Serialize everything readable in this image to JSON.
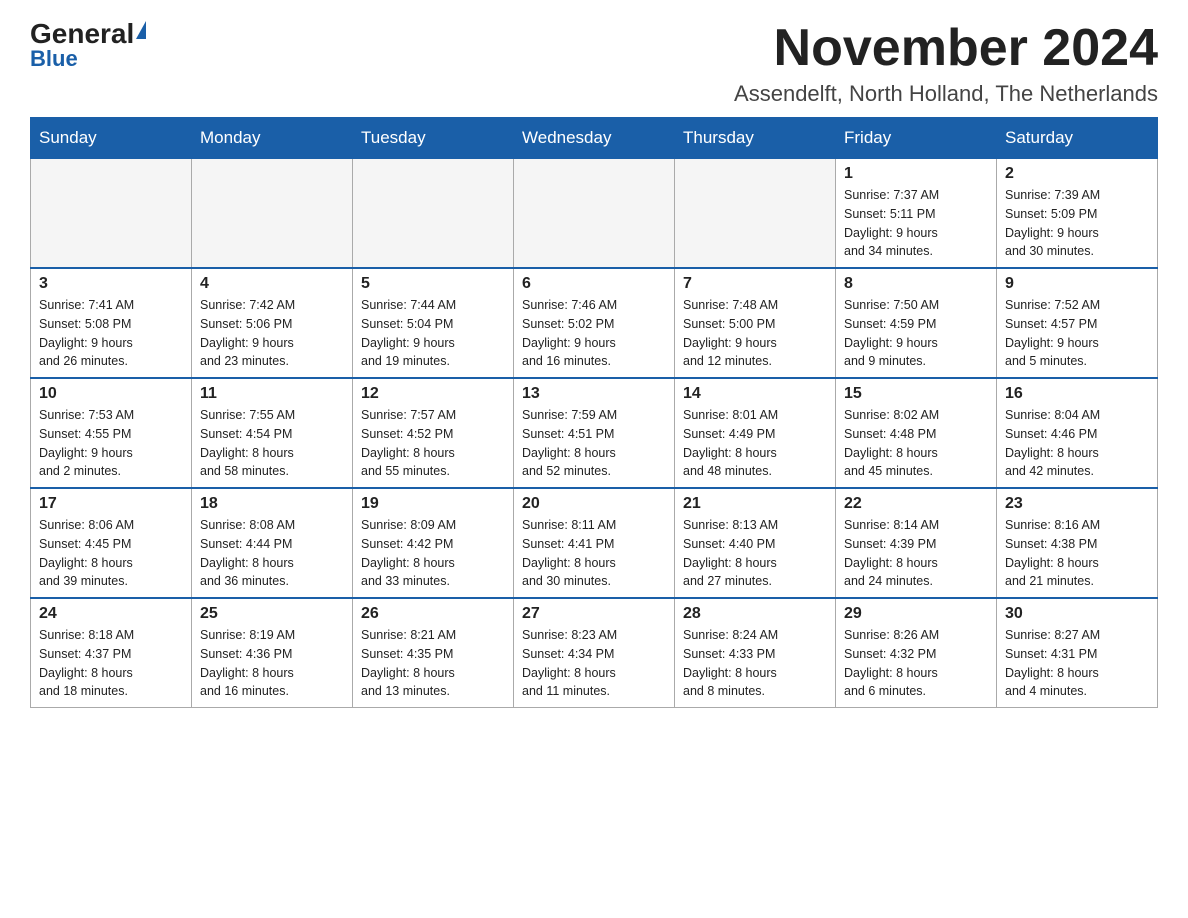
{
  "logo": {
    "general": "General",
    "blue": "Blue"
  },
  "title": {
    "month_year": "November 2024",
    "location": "Assendelft, North Holland, The Netherlands"
  },
  "header_days": [
    "Sunday",
    "Monday",
    "Tuesday",
    "Wednesday",
    "Thursday",
    "Friday",
    "Saturday"
  ],
  "weeks": [
    [
      {
        "day": "",
        "info": ""
      },
      {
        "day": "",
        "info": ""
      },
      {
        "day": "",
        "info": ""
      },
      {
        "day": "",
        "info": ""
      },
      {
        "day": "",
        "info": ""
      },
      {
        "day": "1",
        "info": "Sunrise: 7:37 AM\nSunset: 5:11 PM\nDaylight: 9 hours\nand 34 minutes."
      },
      {
        "day": "2",
        "info": "Sunrise: 7:39 AM\nSunset: 5:09 PM\nDaylight: 9 hours\nand 30 minutes."
      }
    ],
    [
      {
        "day": "3",
        "info": "Sunrise: 7:41 AM\nSunset: 5:08 PM\nDaylight: 9 hours\nand 26 minutes."
      },
      {
        "day": "4",
        "info": "Sunrise: 7:42 AM\nSunset: 5:06 PM\nDaylight: 9 hours\nand 23 minutes."
      },
      {
        "day": "5",
        "info": "Sunrise: 7:44 AM\nSunset: 5:04 PM\nDaylight: 9 hours\nand 19 minutes."
      },
      {
        "day": "6",
        "info": "Sunrise: 7:46 AM\nSunset: 5:02 PM\nDaylight: 9 hours\nand 16 minutes."
      },
      {
        "day": "7",
        "info": "Sunrise: 7:48 AM\nSunset: 5:00 PM\nDaylight: 9 hours\nand 12 minutes."
      },
      {
        "day": "8",
        "info": "Sunrise: 7:50 AM\nSunset: 4:59 PM\nDaylight: 9 hours\nand 9 minutes."
      },
      {
        "day": "9",
        "info": "Sunrise: 7:52 AM\nSunset: 4:57 PM\nDaylight: 9 hours\nand 5 minutes."
      }
    ],
    [
      {
        "day": "10",
        "info": "Sunrise: 7:53 AM\nSunset: 4:55 PM\nDaylight: 9 hours\nand 2 minutes."
      },
      {
        "day": "11",
        "info": "Sunrise: 7:55 AM\nSunset: 4:54 PM\nDaylight: 8 hours\nand 58 minutes."
      },
      {
        "day": "12",
        "info": "Sunrise: 7:57 AM\nSunset: 4:52 PM\nDaylight: 8 hours\nand 55 minutes."
      },
      {
        "day": "13",
        "info": "Sunrise: 7:59 AM\nSunset: 4:51 PM\nDaylight: 8 hours\nand 52 minutes."
      },
      {
        "day": "14",
        "info": "Sunrise: 8:01 AM\nSunset: 4:49 PM\nDaylight: 8 hours\nand 48 minutes."
      },
      {
        "day": "15",
        "info": "Sunrise: 8:02 AM\nSunset: 4:48 PM\nDaylight: 8 hours\nand 45 minutes."
      },
      {
        "day": "16",
        "info": "Sunrise: 8:04 AM\nSunset: 4:46 PM\nDaylight: 8 hours\nand 42 minutes."
      }
    ],
    [
      {
        "day": "17",
        "info": "Sunrise: 8:06 AM\nSunset: 4:45 PM\nDaylight: 8 hours\nand 39 minutes."
      },
      {
        "day": "18",
        "info": "Sunrise: 8:08 AM\nSunset: 4:44 PM\nDaylight: 8 hours\nand 36 minutes."
      },
      {
        "day": "19",
        "info": "Sunrise: 8:09 AM\nSunset: 4:42 PM\nDaylight: 8 hours\nand 33 minutes."
      },
      {
        "day": "20",
        "info": "Sunrise: 8:11 AM\nSunset: 4:41 PM\nDaylight: 8 hours\nand 30 minutes."
      },
      {
        "day": "21",
        "info": "Sunrise: 8:13 AM\nSunset: 4:40 PM\nDaylight: 8 hours\nand 27 minutes."
      },
      {
        "day": "22",
        "info": "Sunrise: 8:14 AM\nSunset: 4:39 PM\nDaylight: 8 hours\nand 24 minutes."
      },
      {
        "day": "23",
        "info": "Sunrise: 8:16 AM\nSunset: 4:38 PM\nDaylight: 8 hours\nand 21 minutes."
      }
    ],
    [
      {
        "day": "24",
        "info": "Sunrise: 8:18 AM\nSunset: 4:37 PM\nDaylight: 8 hours\nand 18 minutes."
      },
      {
        "day": "25",
        "info": "Sunrise: 8:19 AM\nSunset: 4:36 PM\nDaylight: 8 hours\nand 16 minutes."
      },
      {
        "day": "26",
        "info": "Sunrise: 8:21 AM\nSunset: 4:35 PM\nDaylight: 8 hours\nand 13 minutes."
      },
      {
        "day": "27",
        "info": "Sunrise: 8:23 AM\nSunset: 4:34 PM\nDaylight: 8 hours\nand 11 minutes."
      },
      {
        "day": "28",
        "info": "Sunrise: 8:24 AM\nSunset: 4:33 PM\nDaylight: 8 hours\nand 8 minutes."
      },
      {
        "day": "29",
        "info": "Sunrise: 8:26 AM\nSunset: 4:32 PM\nDaylight: 8 hours\nand 6 minutes."
      },
      {
        "day": "30",
        "info": "Sunrise: 8:27 AM\nSunset: 4:31 PM\nDaylight: 8 hours\nand 4 minutes."
      }
    ]
  ]
}
